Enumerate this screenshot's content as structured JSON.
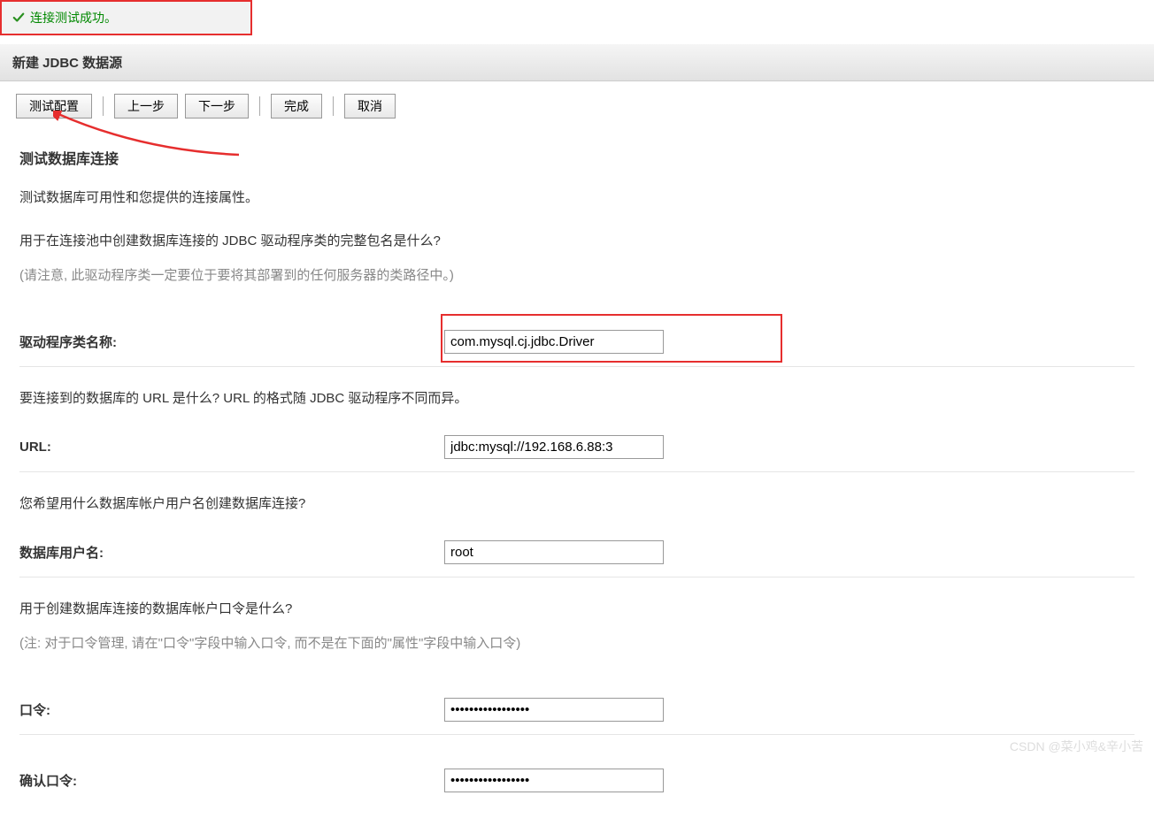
{
  "banner": {
    "message": "连接测试成功。"
  },
  "title": "新建 JDBC 数据源",
  "buttons": {
    "test": "测试配置",
    "prev": "上一步",
    "next": "下一步",
    "finish": "完成",
    "cancel": "取消"
  },
  "section": {
    "heading": "测试数据库连接",
    "desc": "测试数据库可用性和您提供的连接属性。",
    "q_driver1": "用于在连接池中创建数据库连接的 JDBC 驱动程序类的完整包名是什么?",
    "note_driver": "(请注意, 此驱动程序类一定要位于要将其部署到的任何服务器的类路径中。)",
    "q_url": "要连接到的数据库的 URL 是什么? URL 的格式随 JDBC 驱动程序不同而异。",
    "q_user": "您希望用什么数据库帐户用户名创建数据库连接?",
    "q_pass": "用于创建数据库连接的数据库帐户口令是什么?",
    "note_pass": "(注: 对于口令管理, 请在\"口令\"字段中输入口令, 而不是在下面的\"属性\"字段中输入口令)"
  },
  "fields": {
    "driver_label": "驱动程序类名称:",
    "driver_value": "com.mysql.cj.jdbc.Driver",
    "url_label": "URL:",
    "url_value": "jdbc:mysql://192.168.6.88:3",
    "user_label": "数据库用户名:",
    "user_value": "root",
    "pass_label": "口令:",
    "pass_value": "•••••••••••••••••",
    "pass2_label": "确认口令:",
    "pass2_value": "•••••••••••••••••"
  },
  "watermark": "CSDN @菜小鸡&辛小苦"
}
